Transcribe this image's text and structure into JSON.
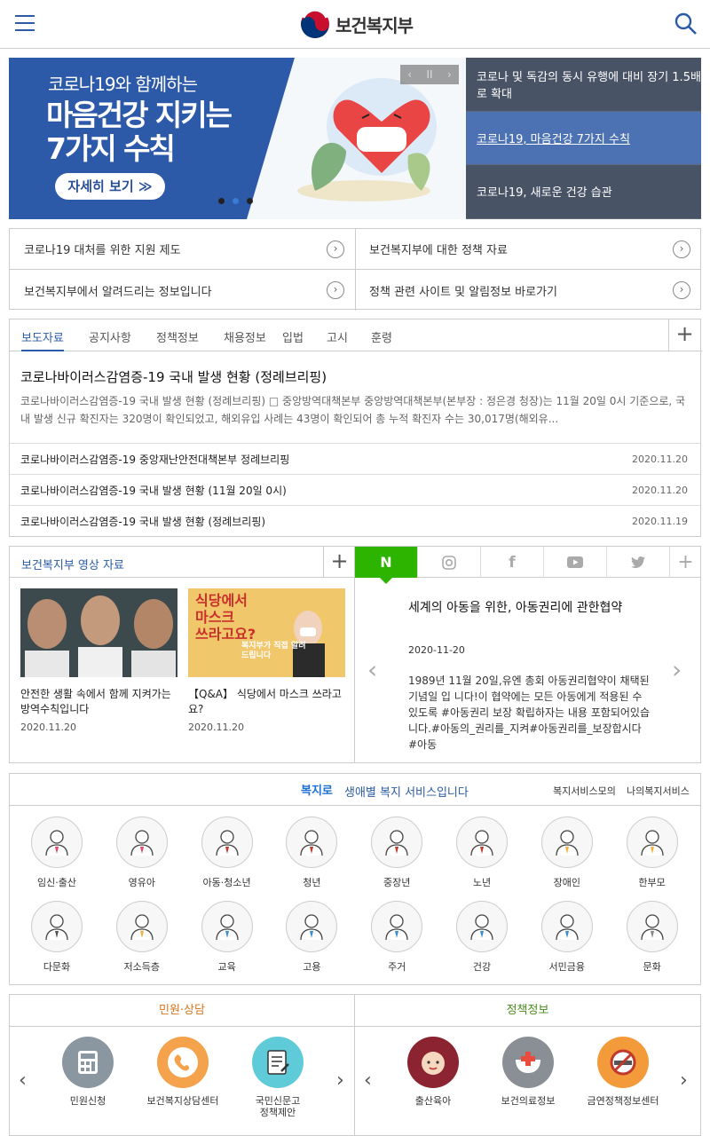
{
  "header": {
    "logo_text": "보건복지부",
    "menu_icon": "hamburger-menu-icon",
    "search_icon": "search-icon"
  },
  "banner": {
    "subtitle": "코로나19와 함께하는",
    "title_line1": "마음건강 지키는",
    "title_line2": "7가지 수칙",
    "button_label": "자세히 보기 ≫",
    "controls": {
      "prev": "‹",
      "pause": "II",
      "next": "›"
    },
    "slide_count": 3,
    "active_slide": 2,
    "side_items": [
      {
        "label": "코로나 및 독감의 동시 유행에 대비 장기 1.5배로 확대"
      },
      {
        "label": "코로나19, 마음건강 7가지 수칙"
      },
      {
        "label": "코로나19, 새로운 건강 습관"
      }
    ]
  },
  "quick_links": [
    {
      "label": "코로나19 대처를 위한 지원 제도"
    },
    {
      "label": "보건복지부에 대한 정책 자료"
    },
    {
      "label": "보건복지부에서 알려드리는 정보입니다"
    },
    {
      "label": "정책 관련 사이트 및 알림정보 바로가기"
    }
  ],
  "news": {
    "tabs": [
      "보도자료",
      "공지사항",
      "정책정보",
      "채용정보",
      "입법",
      "고시",
      "훈령"
    ],
    "active_tab": 0,
    "featured_title": "코로나바이러스감염증-19 국내 발생 현황 (정례브리핑)",
    "featured_body": "코로나바이러스감염증-19 국내 발생 현황 (정례브리핑) □ 중앙방역대책본부 중앙방역대책본부(본부장 : 정은경 청장)는 11월 20일 0시 기준으로, 국내 발생 신규 확진자는 320명이 확인되었고, 해외유입 사례는 43명이 확인되어 총 누적 확진자 수는 30,017명(해외유...",
    "rows": [
      {
        "title": "코로나바이러스감염증-19 중앙재난안전대책본부 정례브리핑",
        "date": "2020.11.20"
      },
      {
        "title": "코로나바이러스감염증-19 국내 발생 현황 (11월 20일 0시)",
        "date": "2020.11.20"
      },
      {
        "title": "코로나바이러스감염증-19 국내 발생 현황 (정례브리핑)",
        "date": "2020.11.19"
      }
    ]
  },
  "video": {
    "title": "보건복지부 영상 자료",
    "items": [
      {
        "caption": "안전한 생활 속에서 함께 지켜가는 방역수칙입니다",
        "date": "2020.11.20"
      },
      {
        "caption": "【Q&A】 식당에서 마스크 쓰라고요?",
        "date": "2020.11.20",
        "thumb_text1": "식당에서",
        "thumb_text2": "마스크",
        "thumb_text3": "쓰라고요?",
        "thumb_side": "복지부가 직접 알려드립니다"
      }
    ]
  },
  "sns": {
    "tabs": [
      "naver-blog-icon",
      "instagram-icon",
      "facebook-icon",
      "youtube-icon",
      "twitter-icon"
    ],
    "title": "세계의 아동을 위한, 아동권리에 관한협약",
    "date": "2020-11-20",
    "body": "1989년 11월 20일,유엔 총회 아동권리협약이 채택된 기념일 입 니다!이 협약에는 모든 아동에게 적용된 수 있도록 #아동권리 보장 확립하자는 내용 포함되어있습니다.#아동의_권리를_지켜#아동권리를_보장합시다#아동"
  },
  "welfare": {
    "logo": "복지로",
    "title": "생애별 복지 서비스입니다",
    "links": [
      "복지서비스모의",
      "나의복지서비스"
    ],
    "items": [
      {
        "label": "임신·출산",
        "icon": "pregnancy-icon"
      },
      {
        "label": "영유아",
        "icon": "infant-icon"
      },
      {
        "label": "아동·청소년",
        "icon": "child-icon"
      },
      {
        "label": "청년",
        "icon": "youth-icon"
      },
      {
        "label": "중장년",
        "icon": "middle-age-icon"
      },
      {
        "label": "노년",
        "icon": "elderly-icon"
      },
      {
        "label": "장애인",
        "icon": "disabled-icon"
      },
      {
        "label": "한부모",
        "icon": "single-parent-icon"
      },
      {
        "label": "다문화",
        "icon": "globe-icon"
      },
      {
        "label": "저소득층",
        "icon": "low-income-icon"
      },
      {
        "label": "교육",
        "icon": "education-icon"
      },
      {
        "label": "고용",
        "icon": "employment-icon"
      },
      {
        "label": "주거",
        "icon": "housing-icon"
      },
      {
        "label": "건강",
        "icon": "health-icon"
      },
      {
        "label": "서민금융",
        "icon": "finance-icon"
      },
      {
        "label": "문화",
        "icon": "culture-icon"
      }
    ]
  },
  "bottom_left": {
    "title": "민원·상담",
    "title_color": "#d9731a",
    "items": [
      {
        "label": "민원신청",
        "icon": "calculator-icon",
        "color": "#8a96a0"
      },
      {
        "label": "보건복지상담센터",
        "icon": "phone-icon",
        "color": "#f4a24b"
      },
      {
        "label": "국민신문고",
        "label2": "정책제안",
        "icon": "document-icon",
        "color": "#5fcbd9"
      }
    ]
  },
  "bottom_right": {
    "title": "정책정보",
    "title_color": "#4a8c1e",
    "items": [
      {
        "label": "출산육아",
        "icon": "baby-icon",
        "color": "#8b2430"
      },
      {
        "label": "보건의료정보",
        "icon": "medical-icon",
        "color": "#8a8f96"
      },
      {
        "label": "금연정책정보센터",
        "icon": "no-smoking-icon",
        "color": "#f39a3a"
      }
    ]
  }
}
